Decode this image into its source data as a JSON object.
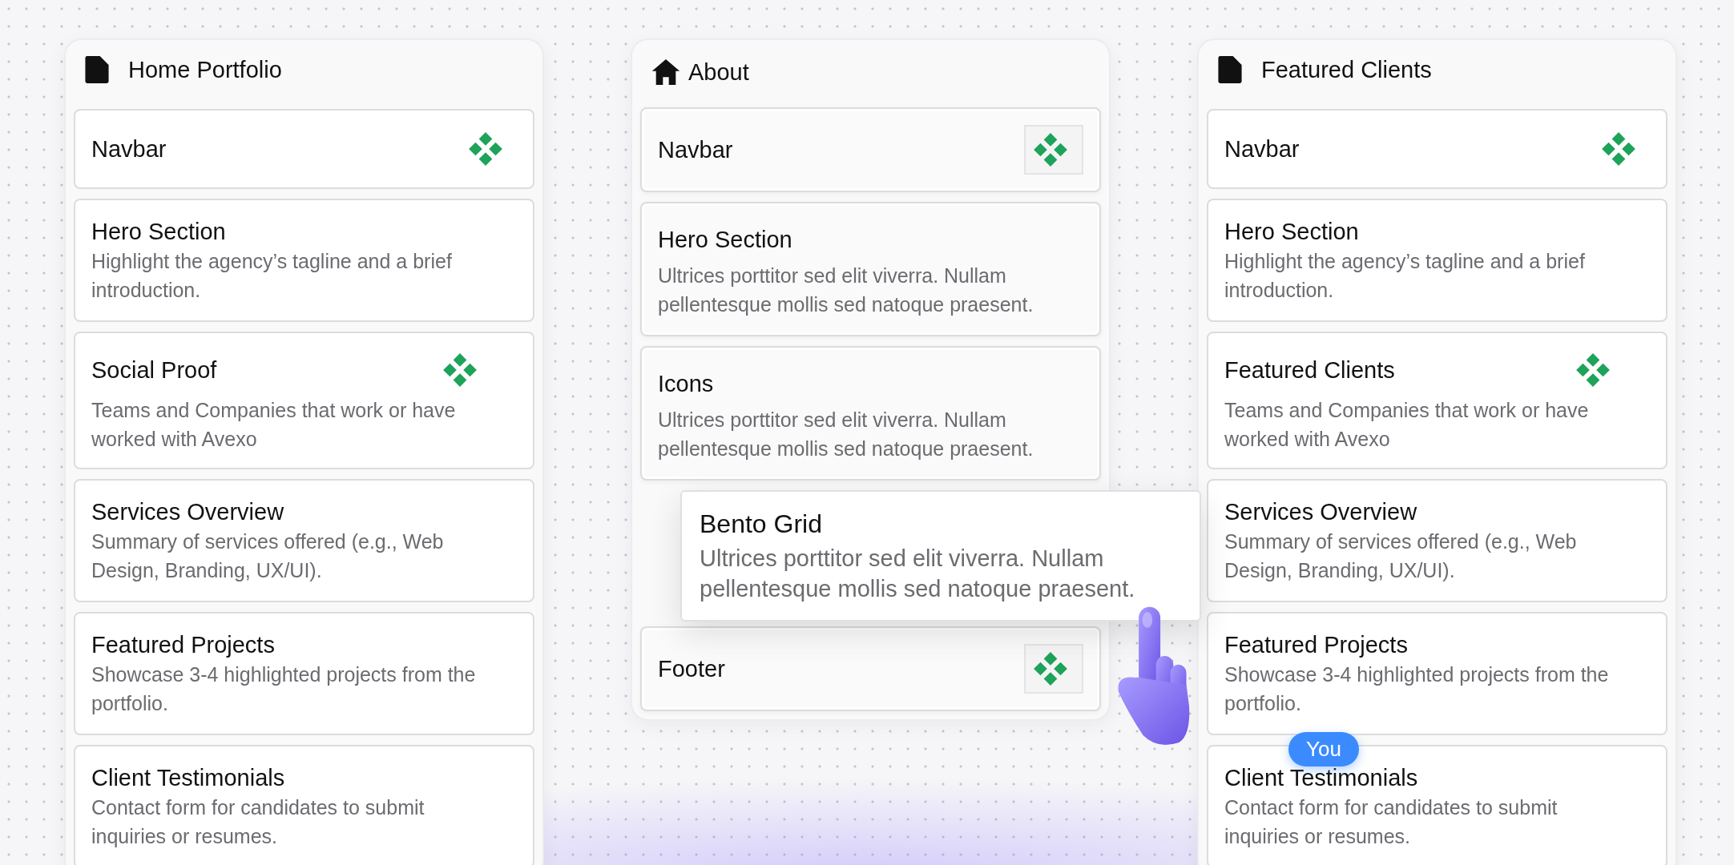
{
  "columns": [
    {
      "title": "Home Portfolio",
      "sections": [
        {
          "kind": "section",
          "title": "Navbar",
          "has_component": true
        },
        {
          "kind": "section",
          "title": "Hero Section",
          "description": "Highlight the agency’s tagline and a brief introduction."
        },
        {
          "kind": "section",
          "title": "Social Proof",
          "description": "Teams and Companies that work or have worked with Avexo",
          "has_component": true
        },
        {
          "kind": "section",
          "title": "Services Overview",
          "description": "Summary of services offered (e.g., Web Design, Branding, UX/UI)."
        },
        {
          "kind": "section",
          "title": "Featured Projects",
          "description": "Showcase 3-4 highlighted projects from the portfolio."
        },
        {
          "kind": "section",
          "title": "Client Testimonials",
          "description": "Contact form for candidates to submit inquiries or resumes."
        }
      ]
    },
    {
      "title": "About",
      "sections": [
        {
          "kind": "section",
          "title": "Navbar",
          "has_component": true
        },
        {
          "kind": "section",
          "title": "Hero Section",
          "description": "Ultrices porttitor sed elit viverra. Nullam pellentesque mollis sed natoque praesent."
        },
        {
          "kind": "section",
          "title": "Icons",
          "description": "Ultrices porttitor sed elit viverra. Nullam pellentesque mollis sed natoque praesent."
        },
        {
          "kind": "drop_slot"
        },
        {
          "kind": "section",
          "title": "Footer",
          "has_component": true
        }
      ]
    },
    {
      "title": "Featured Clients",
      "sections": [
        {
          "kind": "section",
          "title": "Navbar",
          "has_component": true
        },
        {
          "kind": "section",
          "title": "Hero Section",
          "description": "Highlight the agency’s tagline and a brief introduction."
        },
        {
          "kind": "section",
          "title": "Featured Clients",
          "description": "Teams and Companies that work or have worked with Avexo",
          "has_component": true
        },
        {
          "kind": "section",
          "title": "Services Overview",
          "description": "Summary of services offered (e.g., Web Design, Branding, UX/UI)."
        },
        {
          "kind": "section",
          "title": "Featured Projects",
          "description": "Showcase 3-4 highlighted projects from the portfolio."
        },
        {
          "kind": "section",
          "title": "Client Testimonials",
          "description": "Contact form for candidates to submit inquiries or resumes."
        }
      ]
    }
  ],
  "dragged_section": {
    "title": "Bento Grid",
    "description": "Ultrices porttitor sed elit viverra. Nullam pellentesque mollis sed natoque praesent."
  },
  "cursor": {
    "label": "You"
  }
}
